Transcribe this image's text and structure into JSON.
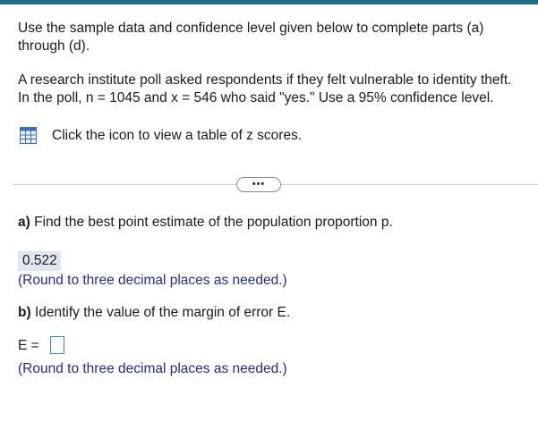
{
  "colors": {
    "top_bar": "#1d6d87",
    "hint_text": "#1f2f8a",
    "answer_fill": "#dde6f1",
    "input_border": "#3b82c4"
  },
  "intro": {
    "line1": "Use the sample data and confidence level given below to complete parts (a)",
    "line2": "through (d)."
  },
  "problem": {
    "line1": "A research institute poll asked respondents if they felt vulnerable to identity theft.",
    "line2": "In the poll, n = 1045 and x = 546 who said \"yes.\" Use a 95% confidence level."
  },
  "z_table": {
    "icon": "table-grid-icon",
    "link_text": "Click the icon to view a table of z scores."
  },
  "more_button": {
    "label": "•••"
  },
  "part_a": {
    "label": "a)",
    "question": " Find the best point estimate of the population proportion p.",
    "answer": "0.522",
    "hint": "(Round to three decimal places as needed.)"
  },
  "part_b": {
    "label": "b)",
    "question": " Identify the value of the margin of error E.",
    "field_label": "E =",
    "field_value": "",
    "hint": "(Round to three decimal places as needed.)"
  }
}
